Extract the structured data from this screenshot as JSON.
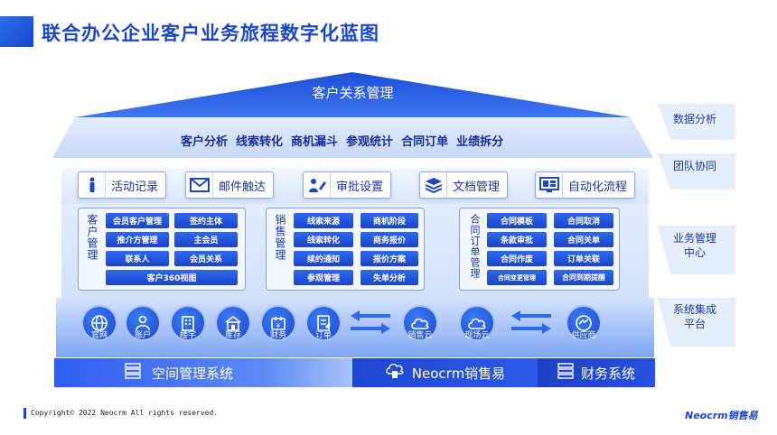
{
  "page": {
    "title": "联合办公企业客户业务旅程数字化蓝图"
  },
  "crm": {
    "title": "客户关系管理",
    "items": [
      "客户分析",
      "线索转化",
      "商机漏斗",
      "参观统计",
      "合同订单",
      "业绩拆分"
    ]
  },
  "collab": {
    "items": [
      {
        "label": "活动记录",
        "icon": "person-icon"
      },
      {
        "label": "邮件触达",
        "icon": "mail-icon"
      },
      {
        "label": "审批设置",
        "icon": "edit-icon"
      },
      {
        "label": "文档管理",
        "icon": "layers-icon"
      },
      {
        "label": "自动化流程",
        "icon": "dashboard-icon"
      }
    ]
  },
  "panels": {
    "customer": {
      "label": "客户管理",
      "items": [
        "会员客户管理",
        "签约主体",
        "推介方管理",
        "主会员",
        "联系人",
        "会员关系",
        "客户360视图"
      ]
    },
    "sales": {
      "label": "销售管理",
      "items": [
        "线索来源",
        "商机阶段",
        "线索转化",
        "商务报价",
        "续约通知",
        "报价方案",
        "参观管理",
        "失单分析"
      ]
    },
    "contract": {
      "label": "合同订单管理",
      "items": [
        "合同模板",
        "合同取消",
        "条款审批",
        "合同关单",
        "合同作废",
        "订单关联",
        "合同变更管理",
        "合同到期提醒"
      ]
    }
  },
  "systems": {
    "items": [
      {
        "label": "官网",
        "icon": "globe-icon"
      },
      {
        "label": "账户",
        "icon": "users-icon"
      },
      {
        "label": "楼宇",
        "icon": "building-icon"
      },
      {
        "label": "库存",
        "icon": "warehouse-icon"
      },
      {
        "label": "财务",
        "icon": "finance-icon"
      },
      {
        "label": "订单",
        "icon": "order-icon"
      },
      {
        "label": "销售云",
        "icon": "cloud-icon"
      },
      {
        "label": "现场云",
        "icon": "cloud-icon"
      },
      {
        "label": "供应商",
        "icon": "supplier-icon"
      }
    ]
  },
  "footer_systems": {
    "space": "空间管理系统",
    "neocrm": "Neocrm销售易",
    "finance": "财务系统"
  },
  "side_labels": {
    "data": "数据分析",
    "team": "团队协同",
    "business": "业务管理中心",
    "system": "系统集成平台"
  },
  "footer": {
    "copyright": "Copyright© 2022 Neocrm All rights reserved.",
    "brand": "Neocrm销售易"
  },
  "colors": {
    "primary": "#1b47c8",
    "accent": "#2f68f0",
    "light": "#d8e5fb"
  }
}
